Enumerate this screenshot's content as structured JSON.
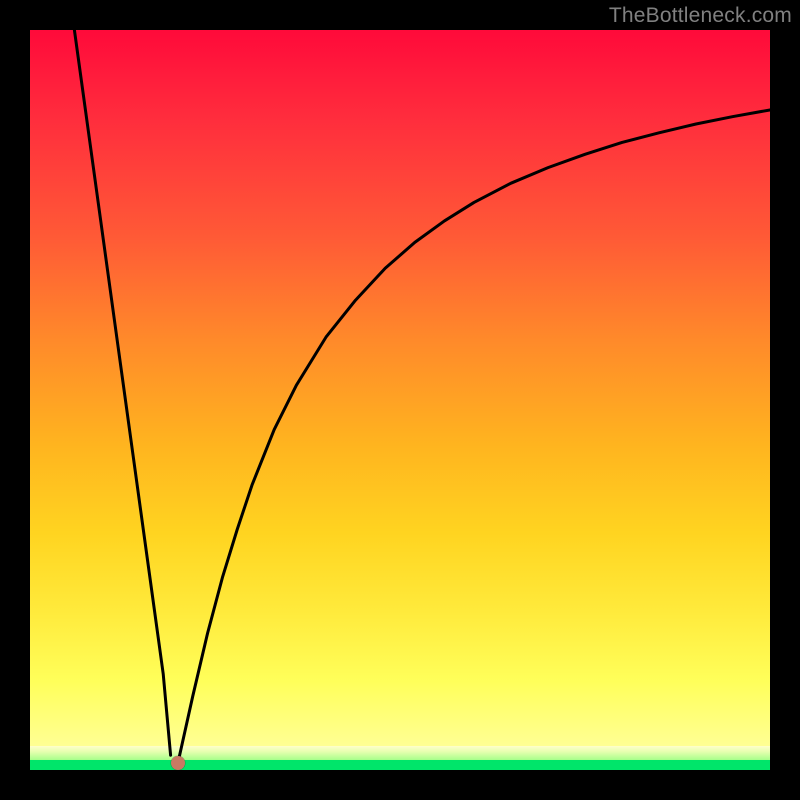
{
  "watermark": {
    "text": "TheBottleneck.com"
  },
  "colors": {
    "background": "#000000",
    "gradient_top": "#ff0a3a",
    "gradient_mid": "#ffd420",
    "gradient_bottom_yellow": "#ffff88",
    "green_band": "#00e56a",
    "curve_stroke": "#000000",
    "marker_fill": "#c97a63"
  },
  "chart_data": {
    "type": "line",
    "title": "",
    "xlabel": "",
    "ylabel": "",
    "xlim": [
      0,
      100
    ],
    "ylim": [
      0,
      100
    ],
    "grid": false,
    "legend": false,
    "background": "red-to-green vertical gradient (red top, green thin band at bottom)",
    "marker": {
      "x": 20,
      "y": 1,
      "color": "#c97a63"
    },
    "series": [
      {
        "name": "left-branch",
        "x": [
          6,
          8,
          10,
          12,
          14,
          16,
          18,
          19
        ],
        "y": [
          100,
          85.5,
          71,
          56.5,
          42,
          27.5,
          13,
          2
        ]
      },
      {
        "name": "right-branch",
        "x": [
          20,
          22,
          24,
          26,
          28,
          30,
          33,
          36,
          40,
          44,
          48,
          52,
          56,
          60,
          65,
          70,
          75,
          80,
          85,
          90,
          95,
          100
        ],
        "y": [
          1,
          10,
          18.5,
          26,
          32.5,
          38.5,
          46,
          52,
          58.5,
          63.5,
          67.8,
          71.3,
          74.2,
          76.7,
          79.3,
          81.4,
          83.2,
          84.8,
          86.1,
          87.3,
          88.3,
          89.2
        ]
      }
    ]
  }
}
